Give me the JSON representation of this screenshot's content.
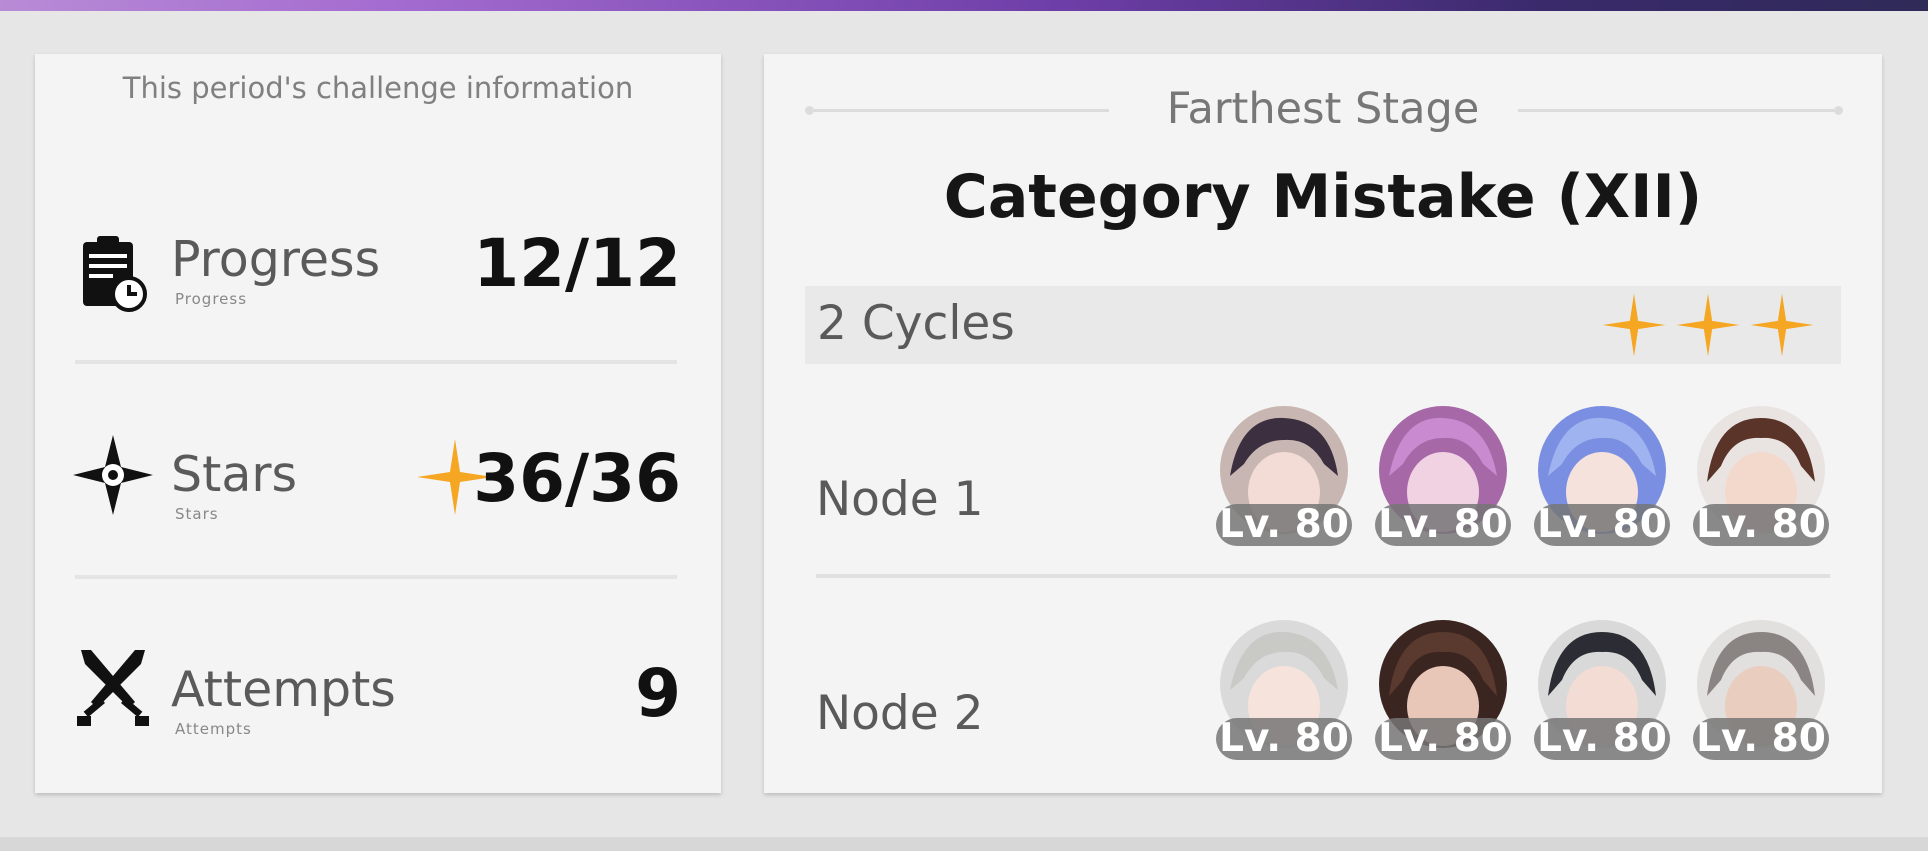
{
  "left_panel": {
    "heading": "This period's challenge information",
    "stats": [
      {
        "label": "Progress",
        "sublabel": "Progress",
        "value": "12/12",
        "icon": "clipboard-clock-icon"
      },
      {
        "label": "Stars",
        "sublabel": "Stars",
        "value": "36/36",
        "icon": "compass-star-icon"
      },
      {
        "label": "Attempts",
        "sublabel": "Attempts",
        "value": "9",
        "icon": "crossed-swords-icon"
      }
    ]
  },
  "right_panel": {
    "heading": "Farthest Stage",
    "stage_title": "Category Mistake (XII)",
    "cycles": "2 Cycles",
    "stars_earned": 3,
    "nodes": [
      {
        "label": "Node 1",
        "characters": [
          {
            "level": "Lv. 80",
            "hair": "#c8b6b2"
          },
          {
            "level": "Lv. 80",
            "hair": "#a768a8"
          },
          {
            "level": "Lv. 80",
            "hair": "#7b8fe2"
          },
          {
            "level": "Lv. 80",
            "hair": "#5a3428"
          }
        ]
      },
      {
        "label": "Node 2",
        "characters": [
          {
            "level": "Lv. 80",
            "hair": "#c9c9c6"
          },
          {
            "level": "Lv. 80",
            "hair": "#5a3a2e"
          },
          {
            "level": "Lv. 80",
            "hair": "#2c2c34"
          },
          {
            "level": "Lv. 80",
            "hair": "#8a8582"
          }
        ]
      }
    ]
  },
  "colors": {
    "star": "#f5a623",
    "panel": "#f4f4f4",
    "background": "#e6e6e6",
    "level_pill": "#767676"
  }
}
